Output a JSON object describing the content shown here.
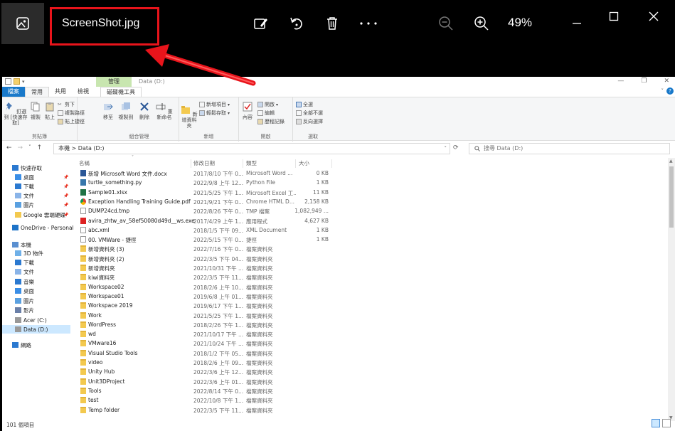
{
  "viewer": {
    "filename": "ScreenShot.jpg",
    "zoom": "49%",
    "icons": [
      "photos-icon",
      "edit-icon",
      "rotate-icon",
      "delete-icon",
      "more-icon",
      "zoom-out-icon",
      "zoom-in-icon"
    ],
    "window_controls": [
      "minimize-icon",
      "maximize-icon",
      "close-icon"
    ],
    "accent": "#e8141b"
  },
  "explorer": {
    "title_path": "Data (D:)",
    "manage_tab": "管理",
    "tabs": [
      "檔案",
      "常用",
      "共用",
      "檢視",
      "磁碟機工具"
    ],
    "ribbon": {
      "clipboard": {
        "label": "剪貼簿",
        "pin": "釘選到 [快速存取]",
        "copy": "複製",
        "paste": "貼上",
        "cut": "剪下",
        "copy_path": "複製路徑",
        "paste_shortcut": "貼上捷徑"
      },
      "organize": {
        "label": "組合管理",
        "move": "移至",
        "copyto": "複製到",
        "delete": "刪除",
        "rename": "重新命名"
      },
      "new": {
        "label": "新增",
        "new_folder": "新增資料夾",
        "new_item": "新增項目",
        "easy_access": "輕鬆存取"
      },
      "open": {
        "label": "開啟",
        "properties": "內容",
        "open": "開啟",
        "edit": "編輯",
        "history": "歷程記錄"
      },
      "select": {
        "label": "選取",
        "all": "全選",
        "none": "全部不選",
        "invert": "反向選擇"
      }
    },
    "address": {
      "path": "本機  >  Data (D:)",
      "search_placeholder": "搜尋 Data (D:)"
    },
    "nav": [
      {
        "label": "快速存取",
        "icon": "star-icon",
        "level": 0
      },
      {
        "label": "桌面",
        "icon": "desktop-icon",
        "level": 1,
        "pinned": true
      },
      {
        "label": "下載",
        "icon": "download-icon",
        "level": 1,
        "pinned": true
      },
      {
        "label": "文件",
        "icon": "document-icon",
        "level": 1,
        "pinned": true
      },
      {
        "label": "圖片",
        "icon": "picture-icon",
        "level": 1,
        "pinned": true
      },
      {
        "label": "Google 雲端硬碟",
        "icon": "folder-icon",
        "level": 1,
        "pinned": true
      },
      {
        "label": "OneDrive - Personal",
        "icon": "cloud-icon",
        "level": 0
      },
      {
        "label": "本機",
        "icon": "computer-icon",
        "level": 0
      },
      {
        "label": "3D 物件",
        "icon": "cube-icon",
        "level": 1
      },
      {
        "label": "下載",
        "icon": "download-icon",
        "level": 1
      },
      {
        "label": "文件",
        "icon": "document-icon",
        "level": 1
      },
      {
        "label": "音樂",
        "icon": "music-icon",
        "level": 1
      },
      {
        "label": "桌面",
        "icon": "desktop-icon",
        "level": 1
      },
      {
        "label": "圖片",
        "icon": "picture-icon",
        "level": 1
      },
      {
        "label": "影片",
        "icon": "video-icon",
        "level": 1
      },
      {
        "label": "Acer (C:)",
        "icon": "drive-icon",
        "level": 1
      },
      {
        "label": "Data (D:)",
        "icon": "drive-icon",
        "level": 1,
        "selected": true
      },
      {
        "label": "網路",
        "icon": "network-icon",
        "level": 0
      }
    ],
    "columns": [
      "名稱",
      "修改日期",
      "類型",
      "大小"
    ],
    "files": [
      {
        "name": "新增 Microsoft Word 文件.docx",
        "date": "2017/8/10 下午 0...",
        "type": "Microsoft Word ...",
        "size": "0 KB",
        "kind": "word"
      },
      {
        "name": "turtle_something.py",
        "date": "2022/9/8 上午 12...",
        "type": "Python File",
        "size": "1 KB",
        "kind": "py"
      },
      {
        "name": "Sample01.xlsx",
        "date": "2021/5/25 下午 1...",
        "type": "Microsoft Excel 工...",
        "size": "11 KB",
        "kind": "excel"
      },
      {
        "name": "Exception Handling Training Guide.pdf",
        "date": "2021/9/21 下午 0...",
        "type": "Chrome HTML D...",
        "size": "2,158 KB",
        "kind": "chrome"
      },
      {
        "name": "DUMP24cd.tmp",
        "date": "2022/8/26 下午 0...",
        "type": "TMP 檔案",
        "size": "1,082,949 ...",
        "kind": "file"
      },
      {
        "name": "avira_zhtw_av_58ef50080d49d__ws.exe",
        "date": "2017/4/29 上午 1...",
        "type": "應用程式",
        "size": "4,627 KB",
        "kind": "exe"
      },
      {
        "name": "abc.xml",
        "date": "2018/1/5 下午 09...",
        "type": "XML Document",
        "size": "1 KB",
        "kind": "file"
      },
      {
        "name": "00. VMWare - 捷徑",
        "date": "2022/5/15 下午 0...",
        "type": "捷徑",
        "size": "1 KB",
        "kind": "file"
      },
      {
        "name": "新增資料夾 (3)",
        "date": "2022/7/16 下午 0...",
        "type": "檔案資料夾",
        "size": "",
        "kind": "folder"
      },
      {
        "name": "新增資料夾 (2)",
        "date": "2022/3/5 下午 04...",
        "type": "檔案資料夾",
        "size": "",
        "kind": "folder"
      },
      {
        "name": "新增資料夾",
        "date": "2021/10/31 下午 ...",
        "type": "檔案資料夾",
        "size": "",
        "kind": "folder"
      },
      {
        "name": "kiwi資料夾",
        "date": "2022/3/5 下午 11...",
        "type": "檔案資料夾",
        "size": "",
        "kind": "folder"
      },
      {
        "name": "Workspace02",
        "date": "2018/2/6 上午 10...",
        "type": "檔案資料夾",
        "size": "",
        "kind": "folder"
      },
      {
        "name": "Workspace01",
        "date": "2019/6/8 上午 01...",
        "type": "檔案資料夾",
        "size": "",
        "kind": "folder"
      },
      {
        "name": "Workspace 2019",
        "date": "2019/6/17 下午 1...",
        "type": "檔案資料夾",
        "size": "",
        "kind": "folder"
      },
      {
        "name": "Work",
        "date": "2021/5/25 下午 1...",
        "type": "檔案資料夾",
        "size": "",
        "kind": "folder"
      },
      {
        "name": "WordPress",
        "date": "2018/2/26 下午 1...",
        "type": "檔案資料夾",
        "size": "",
        "kind": "folder"
      },
      {
        "name": "wd",
        "date": "2021/10/17 下午 ...",
        "type": "檔案資料夾",
        "size": "",
        "kind": "folder"
      },
      {
        "name": "VMware16",
        "date": "2021/10/24 下午 ...",
        "type": "檔案資料夾",
        "size": "",
        "kind": "folder"
      },
      {
        "name": "Visual Studio Tools",
        "date": "2018/1/2 下午 05...",
        "type": "檔案資料夾",
        "size": "",
        "kind": "folder"
      },
      {
        "name": "video",
        "date": "2018/2/6 上午 09...",
        "type": "檔案資料夾",
        "size": "",
        "kind": "folder"
      },
      {
        "name": "Unity Hub",
        "date": "2022/3/6 上午 12...",
        "type": "檔案資料夾",
        "size": "",
        "kind": "folder"
      },
      {
        "name": "Unit3DProject",
        "date": "2022/3/6 上午 01...",
        "type": "檔案資料夾",
        "size": "",
        "kind": "folder"
      },
      {
        "name": "Tools",
        "date": "2022/8/14 下午 0...",
        "type": "檔案資料夾",
        "size": "",
        "kind": "folder"
      },
      {
        "name": "test",
        "date": "2022/10/8 下午 1...",
        "type": "檔案資料夾",
        "size": "",
        "kind": "folder"
      },
      {
        "name": "Temp folder",
        "date": "2022/3/5 下午 11...",
        "type": "檔案資料夾",
        "size": "",
        "kind": "folder"
      }
    ],
    "status": "101 個項目"
  }
}
